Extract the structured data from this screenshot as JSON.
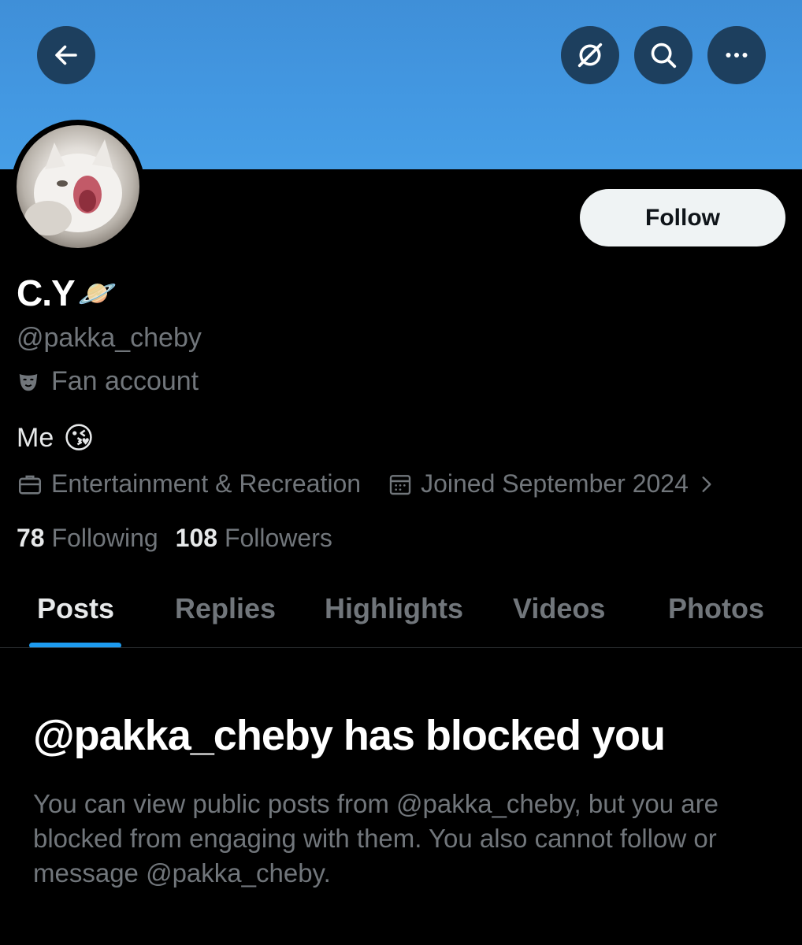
{
  "colors": {
    "banner": "#4398e2",
    "header_button_bg": "#1d3f5e",
    "follow_button_bg": "#eff3f4",
    "accent": "#1d9bf0",
    "muted_text": "#71767b"
  },
  "header": {
    "back_icon": "arrow-left-icon",
    "grok_icon": "grok-slash-icon",
    "search_icon": "search-icon",
    "more_icon": "more-horizontal-icon"
  },
  "profile": {
    "name": "C.Y",
    "name_emoji": "🪐",
    "handle": "@pakka_cheby",
    "category_icon": "mask-icon",
    "category": "Fan account",
    "bio": "Me",
    "bio_emoji": "😘",
    "professional_category": "Entertainment & Recreation",
    "joined": "Joined September 2024",
    "following_count": "78",
    "following_label": "Following",
    "followers_count": "108",
    "followers_label": "Followers",
    "follow_button": "Follow"
  },
  "tabs": [
    "Posts",
    "Replies",
    "Highlights",
    "Videos",
    "Photos"
  ],
  "active_tab": "Posts",
  "blocked": {
    "title": "@pakka_cheby has blocked you",
    "description": "You can view public posts from @pakka_cheby, but you are blocked from engaging with them. You also cannot follow or message @pakka_cheby."
  }
}
